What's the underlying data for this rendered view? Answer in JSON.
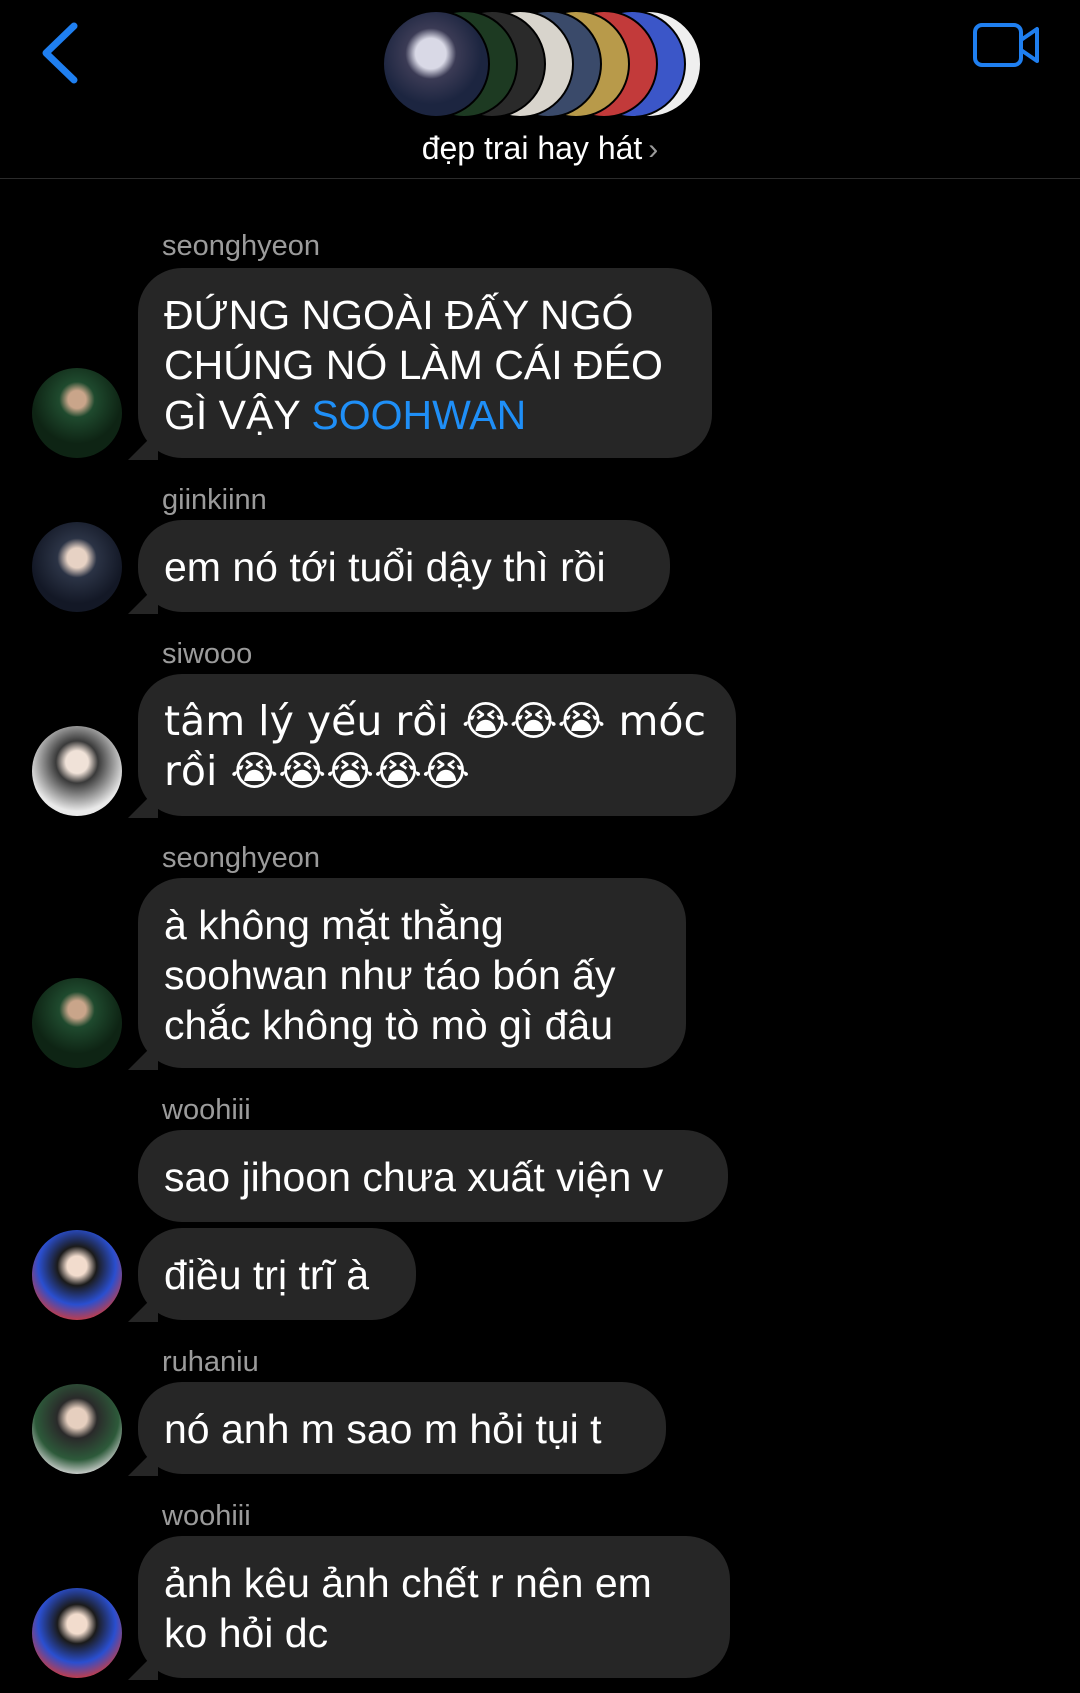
{
  "header": {
    "group_name": "đẹp trai hay hát",
    "chevron": "›",
    "back_icon": "chevron-left-icon",
    "video_icon": "video-camera-icon",
    "accent_color": "#1f7ff0"
  },
  "messages": [
    {
      "sender": "seonghyeon",
      "text": "ĐỨNG NGOÀI ĐẤY NGÓ\nCHÚNG NÓ LÀM CÁI ĐÉO\nGÌ VẬY ",
      "mention": "SOOHWAN"
    },
    {
      "sender": "giinkiinn",
      "text": "em nó tới tuổi dậy thì rồi"
    },
    {
      "sender": "siwooo",
      "text": "tâm lý yếu rồi 😭😭😭 móc\nrồi 😭😭😭😭😭"
    },
    {
      "sender": "seonghyeon",
      "text": "à không mặt thằng\nsoohwan như táo bón ấy\nchắc không tò mò gì đâu"
    },
    {
      "sender": "woohiii",
      "text": "sao jihoon chưa xuất viện v"
    },
    {
      "sender": "",
      "text": "điều trị trĩ à"
    },
    {
      "sender": "ruhaniu",
      "text": "nó anh m sao m hỏi tụi t"
    },
    {
      "sender": "woohiii",
      "text": "ảnh kêu ảnh chết r nên em\nko hỏi dc"
    }
  ]
}
